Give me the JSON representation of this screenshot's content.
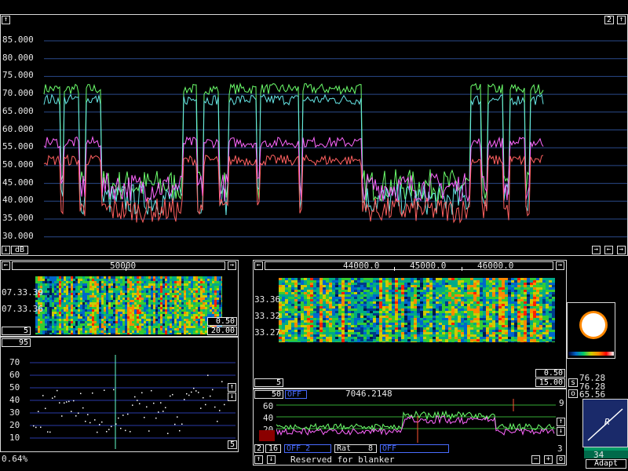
{
  "main_spectrum": {
    "y_labels": [
      "85.000",
      "80.000",
      "75.000",
      "70.000",
      "65.000",
      "60.000",
      "55.000",
      "50.000",
      "45.000",
      "40.000",
      "35.000",
      "30.000"
    ],
    "unit_button": "dB",
    "top_right_value": "2",
    "series_colors": [
      "#6cff6c",
      "#66e6e6",
      "#ff66ff",
      "#ff6060"
    ]
  },
  "waterfall_left": {
    "freq_label": "50000",
    "time_labels": [
      "07.33.39",
      "07.33.36"
    ],
    "min_box": "5",
    "gain_box": "0.50",
    "range_box": "20.00"
  },
  "scatter_left": {
    "top_box": "95",
    "y_labels": [
      "70",
      "60",
      "50",
      "40",
      "30",
      "20",
      "10"
    ],
    "right_box": "5",
    "percent_label": "0.64%"
  },
  "waterfall_right": {
    "freq_labels": [
      "44000.0",
      "45000.0",
      "46000.0"
    ],
    "time_labels": [
      "33.36",
      "33.32",
      "33.27"
    ],
    "min_box": "5",
    "gain_box": "0.50",
    "range_box": "15.00",
    "s_button": "s"
  },
  "signal_meters": {
    "v1": "76.28",
    "v2": "76.28",
    "o_label": "o",
    "v3": "65.56"
  },
  "bottom_spectrum": {
    "level_box": "50",
    "off_label": "OFF",
    "frequency": "7046.2148",
    "y_labels": [
      "60",
      "40",
      "20"
    ],
    "right_top": "9",
    "row_box1": "2",
    "row_box2": "16",
    "off_2_label": "OFF 2",
    "rat_label": "Rat",
    "rat_value": "8",
    "off_3_label": "OFF",
    "value_3": "3",
    "status_text": "Reserved for blanker",
    "right_bottom": "3"
  },
  "agc": {
    "value": "34",
    "mode_button": "Adapt",
    "indicator": "R"
  }
}
